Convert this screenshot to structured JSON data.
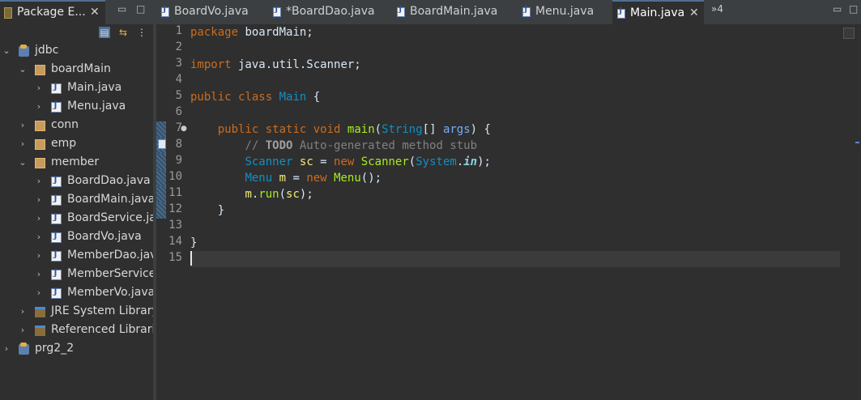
{
  "package_explorer": {
    "tab_title": "Package E...",
    "close": "✕",
    "tree": [
      {
        "indent": 0,
        "arrow": "⌄",
        "icon": "project",
        "label": "jdbc"
      },
      {
        "indent": 1,
        "arrow": "⌄",
        "icon": "package",
        "label": "boardMain"
      },
      {
        "indent": 2,
        "arrow": "›",
        "icon": "java",
        "label": "Main.java"
      },
      {
        "indent": 2,
        "arrow": "›",
        "icon": "java",
        "label": "Menu.java"
      },
      {
        "indent": 1,
        "arrow": "›",
        "icon": "package",
        "label": "conn"
      },
      {
        "indent": 1,
        "arrow": "›",
        "icon": "package",
        "label": "emp"
      },
      {
        "indent": 1,
        "arrow": "⌄",
        "icon": "package",
        "label": "member"
      },
      {
        "indent": 2,
        "arrow": "›",
        "icon": "java",
        "label": "BoardDao.java"
      },
      {
        "indent": 2,
        "arrow": "›",
        "icon": "java",
        "label": "BoardMain.java"
      },
      {
        "indent": 2,
        "arrow": "›",
        "icon": "java",
        "label": "BoardService.java"
      },
      {
        "indent": 2,
        "arrow": "›",
        "icon": "java",
        "label": "BoardVo.java"
      },
      {
        "indent": 2,
        "arrow": "›",
        "icon": "java",
        "label": "MemberDao.java"
      },
      {
        "indent": 2,
        "arrow": "›",
        "icon": "java",
        "label": "MemberService.java"
      },
      {
        "indent": 2,
        "arrow": "›",
        "icon": "java",
        "label": "MemberVo.java"
      },
      {
        "indent": 1,
        "arrow": "›",
        "icon": "library",
        "label": "JRE System Library"
      },
      {
        "indent": 1,
        "arrow": "›",
        "icon": "library",
        "label": "Referenced Libraries"
      },
      {
        "indent": 0,
        "arrow": "›",
        "icon": "project",
        "label": "prg2_2"
      }
    ]
  },
  "editor": {
    "tabs": [
      {
        "label": "BoardVo.java",
        "active": false
      },
      {
        "label": "*BoardDao.java",
        "active": false
      },
      {
        "label": "BoardMain.java",
        "active": false
      },
      {
        "label": "Menu.java",
        "active": false
      },
      {
        "label": "Main.java",
        "active": true
      }
    ],
    "overflow_label": "»4",
    "line_numbers": [
      "1",
      "2",
      "3",
      "4",
      "5",
      "6",
      "7",
      "8",
      "9",
      "10",
      "11",
      "12",
      "13",
      "14",
      "15"
    ],
    "code_lines": [
      [
        {
          "t": "package",
          "c": "kw"
        },
        {
          "t": " boardMain;",
          "c": ""
        }
      ],
      [],
      [
        {
          "t": "import",
          "c": "kw"
        },
        {
          "t": " java.util.Scanner;",
          "c": ""
        }
      ],
      [],
      [
        {
          "t": "public",
          "c": "kw"
        },
        {
          "t": " ",
          "c": ""
        },
        {
          "t": "class",
          "c": "kw"
        },
        {
          "t": " ",
          "c": ""
        },
        {
          "t": "Main",
          "c": "cls"
        },
        {
          "t": " {",
          "c": ""
        }
      ],
      [],
      [
        {
          "t": "    ",
          "c": ""
        },
        {
          "t": "public",
          "c": "kw"
        },
        {
          "t": " ",
          "c": ""
        },
        {
          "t": "static",
          "c": "kw"
        },
        {
          "t": " ",
          "c": ""
        },
        {
          "t": "void",
          "c": "kw"
        },
        {
          "t": " ",
          "c": ""
        },
        {
          "t": "main",
          "c": "meth"
        },
        {
          "t": "(",
          "c": ""
        },
        {
          "t": "String",
          "c": "cls"
        },
        {
          "t": "[] ",
          "c": ""
        },
        {
          "t": "args",
          "c": "par"
        },
        {
          "t": ") {",
          "c": ""
        }
      ],
      [
        {
          "t": "        ",
          "c": ""
        },
        {
          "t": "// ",
          "c": "cmt"
        },
        {
          "t": "TODO",
          "c": "todo"
        },
        {
          "t": " Auto-generated method stub",
          "c": "cmt"
        }
      ],
      [
        {
          "t": "        ",
          "c": ""
        },
        {
          "t": "Scanner",
          "c": "cls"
        },
        {
          "t": " ",
          "c": ""
        },
        {
          "t": "sc",
          "c": "var"
        },
        {
          "t": " = ",
          "c": ""
        },
        {
          "t": "new",
          "c": "kw"
        },
        {
          "t": " ",
          "c": ""
        },
        {
          "t": "Scanner",
          "c": "meth"
        },
        {
          "t": "(",
          "c": ""
        },
        {
          "t": "System",
          "c": "cls"
        },
        {
          "t": ".",
          "c": ""
        },
        {
          "t": "in",
          "c": "stat"
        },
        {
          "t": ");",
          "c": ""
        }
      ],
      [
        {
          "t": "        ",
          "c": ""
        },
        {
          "t": "Menu",
          "c": "cls"
        },
        {
          "t": " ",
          "c": ""
        },
        {
          "t": "m",
          "c": "var"
        },
        {
          "t": " = ",
          "c": ""
        },
        {
          "t": "new",
          "c": "kw"
        },
        {
          "t": " ",
          "c": ""
        },
        {
          "t": "Menu",
          "c": "meth"
        },
        {
          "t": "();",
          "c": ""
        }
      ],
      [
        {
          "t": "        ",
          "c": ""
        },
        {
          "t": "m",
          "c": "var"
        },
        {
          "t": ".",
          "c": ""
        },
        {
          "t": "run",
          "c": "meth"
        },
        {
          "t": "(",
          "c": ""
        },
        {
          "t": "sc",
          "c": "var"
        },
        {
          "t": ");",
          "c": ""
        }
      ],
      [
        {
          "t": "    }",
          "c": ""
        }
      ],
      [],
      [
        {
          "t": "}",
          "c": ""
        }
      ],
      []
    ],
    "current_line": 15,
    "colors": {
      "keyword": "#cc6c1d",
      "class": "#1290c3",
      "method": "#a7ec21",
      "variable": "#f3ec79",
      "parameter": "#79abff",
      "comment": "#808080",
      "background": "#2f2f2f"
    }
  }
}
